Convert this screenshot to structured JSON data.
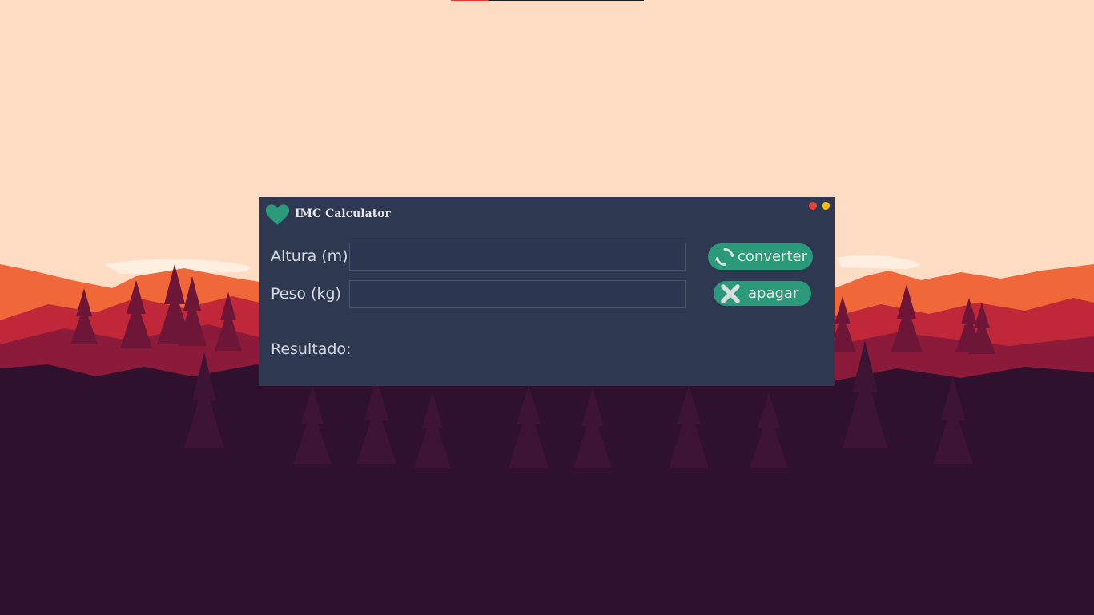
{
  "window": {
    "title": "IMC Calculator",
    "app_icon": "heart-icon",
    "controls": [
      "close",
      "minimize"
    ]
  },
  "form": {
    "height_label": "Altura (m)",
    "height_value": "",
    "weight_label": "Peso (kg)",
    "weight_value": ""
  },
  "buttons": {
    "convert_label": "converter",
    "convert_icon": "refresh-icon",
    "clear_label": "apagar",
    "clear_icon": "close-icon"
  },
  "result": {
    "label": "Resultado:",
    "value": ""
  },
  "colors": {
    "window_bg": "#2f3851",
    "accent": "#2b9a7a",
    "close_dot": "#e8413a",
    "minimize_dot": "#f2bf12",
    "sky": "#ffdcc3"
  }
}
